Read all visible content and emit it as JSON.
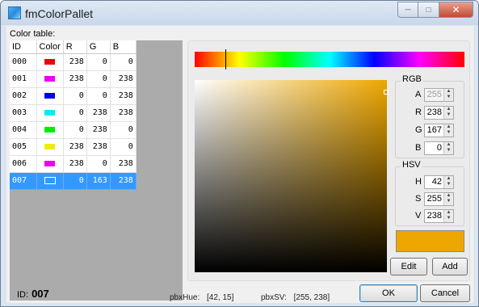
{
  "window": {
    "title": "fmColorPallet",
    "minimize_icon": "minimize-icon",
    "maximize_icon": "maximize-icon",
    "close_icon": "close-icon"
  },
  "color_table": {
    "label": "Color table:",
    "columns": [
      "ID",
      "Color",
      "R",
      "G",
      "B"
    ],
    "rows": [
      {
        "id": "000",
        "color": "#ee0000",
        "r": "238",
        "g": "0",
        "b": "0"
      },
      {
        "id": "001",
        "color": "#ee00ee",
        "r": "238",
        "g": "0",
        "b": "238"
      },
      {
        "id": "002",
        "color": "#0000ee",
        "r": "0",
        "g": "0",
        "b": "238"
      },
      {
        "id": "003",
        "color": "#00eeee",
        "r": "0",
        "g": "238",
        "b": "238"
      },
      {
        "id": "004",
        "color": "#00ee00",
        "r": "0",
        "g": "238",
        "b": "0"
      },
      {
        "id": "005",
        "color": "#eeee00",
        "r": "238",
        "g": "238",
        "b": "0"
      },
      {
        "id": "006",
        "color": "#ee00ee",
        "r": "238",
        "g": "0",
        "b": "238"
      },
      {
        "id": "007",
        "color": "#00a3ee",
        "r": "0",
        "g": "163",
        "b": "238"
      }
    ],
    "selected_index": 7
  },
  "picker": {
    "hue": 42,
    "sv": {
      "s": 255,
      "v": 238
    },
    "current_color": "#eea700"
  },
  "rgb": {
    "title": "RGB",
    "fields": [
      {
        "label": "A",
        "value": "255",
        "disabled": true
      },
      {
        "label": "R",
        "value": "238"
      },
      {
        "label": "G",
        "value": "167"
      },
      {
        "label": "B",
        "value": "0"
      }
    ]
  },
  "hsv": {
    "title": "HSV",
    "fields": [
      {
        "label": "H",
        "value": "42"
      },
      {
        "label": "S",
        "value": "255"
      },
      {
        "label": "V",
        "value": "238"
      }
    ]
  },
  "buttons": {
    "edit": "Edit",
    "add": "Add",
    "ok": "OK",
    "cancel": "Cancel"
  },
  "footer": {
    "id_label": "ID:",
    "id_value": "007",
    "hue_label": "pbxHue:",
    "hue_value": "[42, 15]",
    "sv_label": "pbxSV:",
    "sv_value": "[255, 238]"
  }
}
